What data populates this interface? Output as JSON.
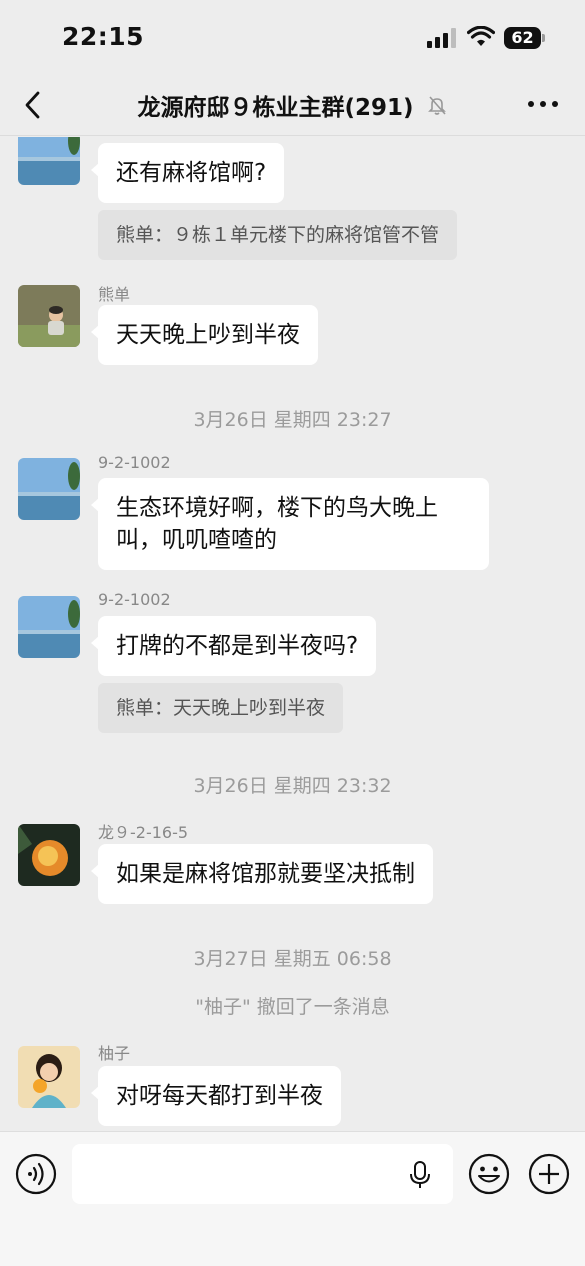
{
  "status_bar": {
    "time": "22:15",
    "battery": "62"
  },
  "nav": {
    "title": "龙源府邸９栋业主群(291)"
  },
  "messages": [
    {
      "sender": "",
      "text": "还有麻将馆啊?",
      "quote": "熊单：９栋１单元楼下的麻将馆管不管"
    },
    {
      "sender": "熊单",
      "text": "天天晚上吵到半夜"
    },
    {
      "timestamp": "3月26日 星期四 23:27"
    },
    {
      "sender": "9-2-1002",
      "text_lines": [
        "生态环境好啊，楼下的鸟大晚上",
        "叫，叽叽喳喳的"
      ]
    },
    {
      "sender": "9-2-1002",
      "text": "打牌的不都是到半夜吗?",
      "quote": "熊单：天天晚上吵到半夜"
    },
    {
      "timestamp": "3月26日 星期四 23:32"
    },
    {
      "sender": "龙９-2-16-5",
      "text": "如果是麻将馆那就要坚决抵制"
    },
    {
      "timestamp": "3月27日 星期五 06:58"
    },
    {
      "system": "\"柚子\" 撤回了一条消息"
    },
    {
      "sender": "柚子",
      "text": "对呀每天都打到半夜"
    }
  ],
  "colors": {
    "background": "#ededed",
    "bubble": "#ffffff",
    "quote_bg": "#e2e2e2",
    "meta_text": "#9b9b9b"
  },
  "icons": [
    "signal-icon",
    "wifi-icon",
    "battery-icon",
    "back-icon",
    "mute-icon",
    "more-icon",
    "voice-icon",
    "mic-icon",
    "emoji-icon",
    "plus-icon"
  ]
}
